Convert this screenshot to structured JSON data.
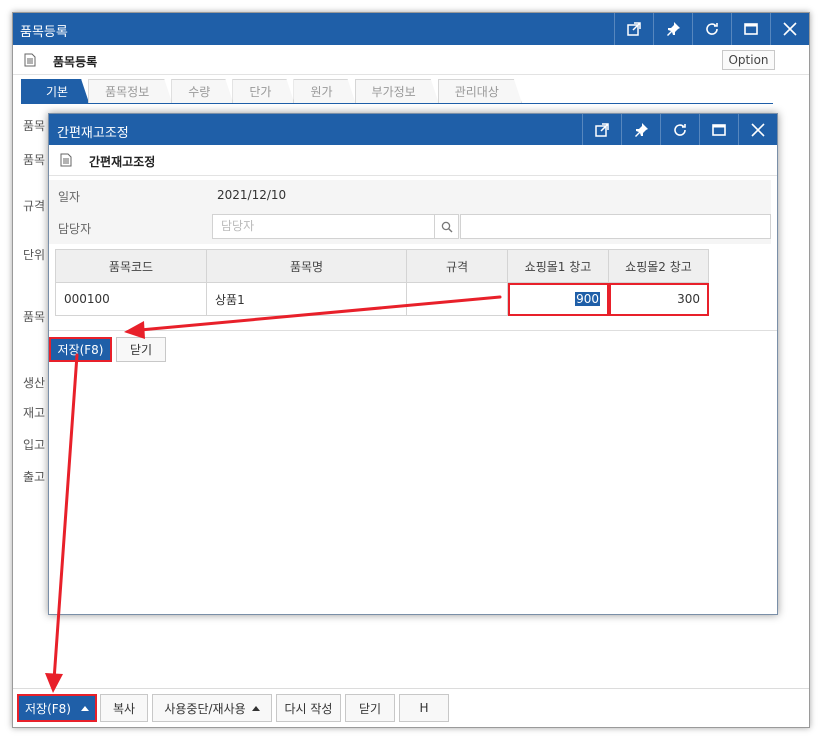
{
  "outer": {
    "title": "품목등록",
    "subtitle": "품목등록",
    "option_label": "Option",
    "tabs": [
      {
        "label": "기본"
      },
      {
        "label": "품목정보"
      },
      {
        "label": "수량"
      },
      {
        "label": "단가"
      },
      {
        "label": "원가"
      },
      {
        "label": "부가정보"
      },
      {
        "label": "관리대상"
      }
    ],
    "field_labels": [
      "품목",
      "품목",
      "규격",
      "단위",
      "품목",
      "생산",
      "재고",
      "입고",
      "출고"
    ],
    "bottom_buttons": {
      "save": "저장(F8)",
      "copy": "복사",
      "toggle_use": "사용중단/재사용",
      "rewrite": "다시 작성",
      "close": "닫기",
      "h": "H"
    }
  },
  "dialog": {
    "title": "간편재고조정",
    "subtitle": "간편재고조정",
    "date_label": "일자",
    "date_value": "2021/12/10",
    "manager_label": "담당자",
    "manager_placeholder": "담당자",
    "grid": {
      "columns": [
        "품목코드",
        "품목명",
        "규격",
        "쇼핑몰1 창고",
        "쇼핑몰2 창고"
      ],
      "rows": [
        {
          "code": "000100",
          "name": "상품1",
          "spec": "",
          "wh1": "900",
          "wh2": "300"
        }
      ]
    },
    "buttons": {
      "save": "저장(F8)",
      "close": "닫기"
    }
  },
  "colors": {
    "accent": "#1f5fa8",
    "annotation": "#e8202a"
  }
}
